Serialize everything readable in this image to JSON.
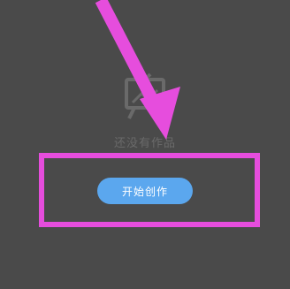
{
  "empty_state": {
    "icon": "easel-canvas-icon",
    "message": "还没有作品"
  },
  "cta": {
    "start_label": "开始创作"
  },
  "annotation": {
    "icon": "arrow-pointer-icon",
    "color": "#e64ddd"
  },
  "colors": {
    "background": "#4a4a4a",
    "button": "#5ba7ee",
    "highlight": "#e64ddd"
  }
}
